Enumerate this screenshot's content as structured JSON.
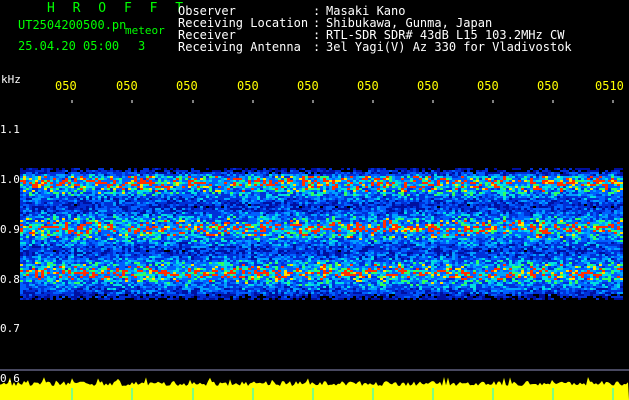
{
  "header": {
    "title": "H R O F F T",
    "file_name": "UT2504200500.pn",
    "meteor_label": "meteor",
    "date_time": "25.04.20 05:00",
    "meteor_count": "3"
  },
  "metadata": [
    {
      "key": "Observer",
      "value": "Masaki Kano"
    },
    {
      "key": "Receiving Location",
      "value": "Shibukawa, Gunma, Japan"
    },
    {
      "key": "Receiver",
      "value": "RTL-SDR SDR# 43dB L15 103.2MHz CW"
    },
    {
      "key": "Receiving Antenna",
      "value": "3el Yagi(V) Az 330 for Vladivostok"
    }
  ],
  "axis": {
    "unit": "kHz",
    "time_ticks": [
      "050",
      "050",
      "050",
      "050",
      "050",
      "050",
      "050",
      "050",
      "050",
      "0510"
    ],
    "freq_ticks": [
      "1.1",
      "1.0",
      "0.9",
      "0.8",
      "0.7",
      "0.6"
    ]
  },
  "colors": {
    "header_text": "#00ff00",
    "label_text": "#ffffff",
    "tick_text": "#ffff00",
    "background": "#000000",
    "signal_strip": "#ffff00"
  }
}
